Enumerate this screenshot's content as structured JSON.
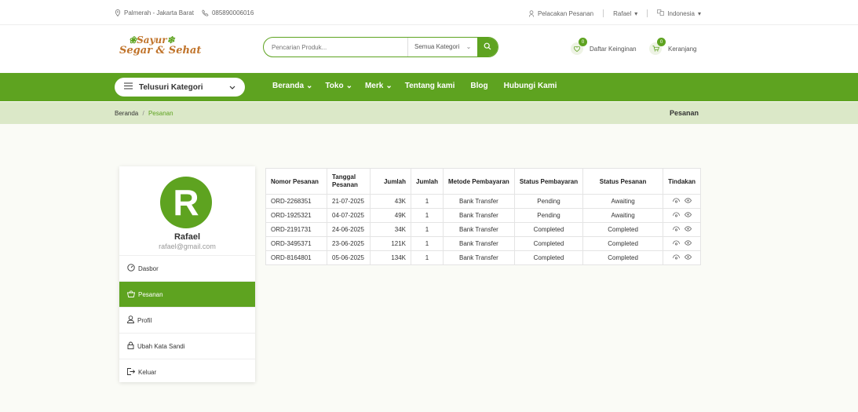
{
  "topbar": {
    "address": "Palmerah - Jakarta Barat",
    "phone": "085890006016",
    "track_order": "Pelacakan Pesanan",
    "user": "Rafael",
    "language": "Indonesia"
  },
  "header": {
    "logo_line1": "Sayur",
    "logo_line2": "Segar & Sehat",
    "search_placeholder": "Pencarian Produk...",
    "category_select": "Semua Kategori",
    "wishlist_label": "Daftar Keinginan",
    "wishlist_count": "0",
    "cart_label": "Keranjang",
    "cart_count": "0"
  },
  "nav": {
    "browse_label": "Telusuri Kategori",
    "items": [
      "Beranda",
      "Toko",
      "Merk",
      "Tentang kami",
      "Blog",
      "Hubungi Kami"
    ]
  },
  "breadcrumb": {
    "home": "Beranda",
    "separator": "/",
    "current": "Pesanan",
    "page_title": "Pesanan"
  },
  "sidebar": {
    "avatar_letter": "R",
    "name": "Rafael",
    "email": "rafael@gmail.com",
    "items": [
      {
        "label": "Dasbor",
        "icon": "dashboard-icon"
      },
      {
        "label": "Pesanan",
        "icon": "basket-icon"
      },
      {
        "label": "Profil",
        "icon": "user-icon"
      },
      {
        "label": "Ubah Kata Sandi",
        "icon": "lock-icon"
      },
      {
        "label": "Keluar",
        "icon": "logout-icon"
      }
    ],
    "active_index": 1
  },
  "orders": {
    "headers": [
      "Nomor Pesanan",
      "Tanggal\nPesanan",
      "Jumlah",
      "Jumlah",
      "Metode Pembayaran",
      "Status Pembayaran",
      "Status Pesanan",
      "Tindakan"
    ],
    "rows": [
      [
        "ORD-2268351",
        "21-07-2025",
        "43K",
        "1",
        "Bank Transfer",
        "Pending",
        "Awaiting"
      ],
      [
        "ORD-1925321",
        "04-07-2025",
        "49K",
        "1",
        "Bank Transfer",
        "Pending",
        "Awaiting"
      ],
      [
        "ORD-2191731",
        "24-06-2025",
        "34K",
        "1",
        "Bank Transfer",
        "Completed",
        "Completed"
      ],
      [
        "ORD-3495371",
        "23-06-2025",
        "121K",
        "1",
        "Bank Transfer",
        "Completed",
        "Completed"
      ],
      [
        "ORD-8164801",
        "05-06-2025",
        "134K",
        "1",
        "Bank Transfer",
        "Completed",
        "Completed"
      ]
    ]
  },
  "colors": {
    "brand_green": "#5ea320",
    "logo_orange": "#c0732a",
    "breadcrumb_bg": "#dbe8c8"
  }
}
